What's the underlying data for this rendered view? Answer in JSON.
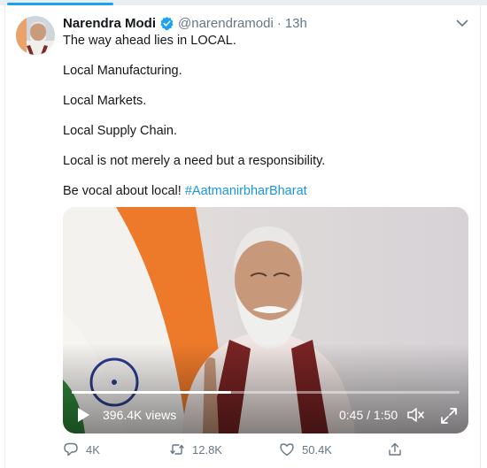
{
  "tweet": {
    "author_name": "Narendra Modi",
    "author_handle": "@narendramodi",
    "separator": "·",
    "time_ago": "13h",
    "lines": [
      "The way ahead lies in LOCAL.",
      "Local Manufacturing.",
      "Local Markets.",
      "Local Supply Chain.",
      "Local is not merely a need but a responsibility."
    ],
    "last_line_prefix": "Be vocal about local! ",
    "hashtag": "#AatmanirbharBharat"
  },
  "video": {
    "views": "396.4K views",
    "time": "0:45 / 1:50",
    "progress_fraction": 0.41
  },
  "actions": {
    "replies": "4K",
    "retweets": "12.8K",
    "likes": "50.4K"
  },
  "icons": {
    "verified": "verified-badge-icon",
    "caret": "chevron-down-icon",
    "play": "play-icon",
    "volume": "volume-icon",
    "fullscreen": "fullscreen-icon",
    "reply": "reply-icon",
    "retweet": "retweet-icon",
    "like": "heart-icon",
    "share": "share-icon"
  },
  "colors": {
    "link": "#1b95e0",
    "verified": "#1da1f2",
    "secondary_text": "#657786"
  }
}
